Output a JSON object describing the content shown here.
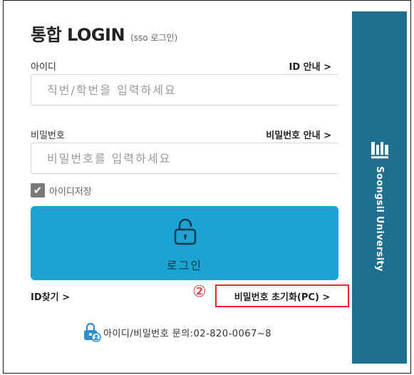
{
  "header": {
    "title": "통합 LOGIN",
    "subtitle": "(sso 로그인)"
  },
  "id_field": {
    "label": "아이디",
    "guide_link": "ID 안내 >",
    "placeholder": "직번/학번을 입력하세요",
    "value": ""
  },
  "password_field": {
    "label": "비밀번호",
    "guide_link": "비밀번호 안내 >",
    "placeholder": "비밀번호를 입력하세요",
    "value": ""
  },
  "remember": {
    "label": "아이디저장",
    "checked": true
  },
  "login_button": {
    "label": "로그인",
    "icon": "lock-icon",
    "color": "#1ba3d3"
  },
  "links": {
    "find_id": "ID찾기 >",
    "annotation_number": "②",
    "reset_password": "비밀번호 초기화(PC) >"
  },
  "contact": {
    "text": "아이디/비밀번호 문의:02-820-0067~8",
    "icon": "lock-person-icon"
  },
  "brand": {
    "name": "Soongsil University",
    "color": "#1f6f91",
    "logo_icon": "soongsil-logo-icon"
  },
  "colors": {
    "highlight": "#e8262c"
  }
}
